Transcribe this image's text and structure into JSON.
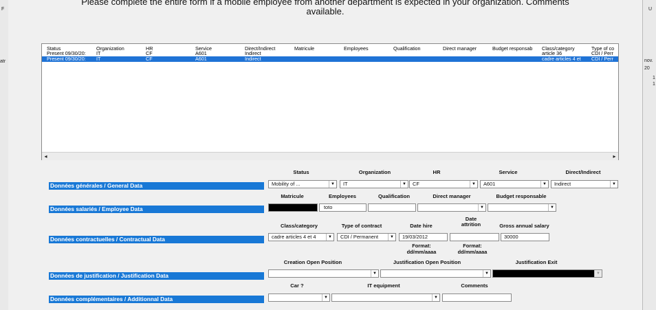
{
  "dialog": {
    "header_line1": "Please complete the entire form if a mobile employee from another department is expected in your organization. Comments",
    "header_line2": "available."
  },
  "background": {
    "left_letter": "F",
    "left_text": "atr",
    "right_letter": "U",
    "right_text1": "nov.",
    "right_text2": "20",
    "right_text3": "1",
    "right_text4": "1"
  },
  "list": {
    "columns": [
      "Status",
      "Organization",
      "HR",
      "Service",
      "Direct/Indirect",
      "Matricule",
      "Employees",
      "Qualification",
      "Direct manager",
      "Budget responsab",
      "Class/category",
      "Type of co"
    ],
    "rows": [
      {
        "cells": [
          "Present 09/30/20:",
          "IT",
          "CF",
          "A601",
          "Indirect",
          "",
          "",
          "",
          "",
          "",
          "article 36",
          "CDI / Perr"
        ],
        "selected": false
      },
      {
        "cells": [
          "Present 09/30/20:",
          "IT",
          "CF",
          "A601",
          "Indirect",
          "",
          "",
          "",
          "",
          "",
          "cadre articles 4 et",
          "CDI / Perr"
        ],
        "selected": true
      }
    ],
    "scroll_left": "◂",
    "scroll_right": "▸"
  },
  "general": {
    "label": "Données générales / General Data",
    "headers": {
      "status": "Status",
      "organization": "Organization",
      "hr": "HR",
      "service": "Service",
      "direct": "Direct/Indirect"
    },
    "values": {
      "status": "Mobility of ...",
      "organization": "IT",
      "hr": "CF",
      "service": "A601",
      "direct": "Indirect"
    }
  },
  "employee": {
    "label": "Données salariés / Employee Data",
    "headers": {
      "matricule": "Matricule",
      "employees": "Employees",
      "qualification": "Qualification",
      "manager": "Direct manager",
      "budget": "Budget responsable"
    },
    "values": {
      "matricule": "",
      "employees": "toto",
      "qualification": "",
      "manager": "",
      "budget": ""
    }
  },
  "contract": {
    "label": "Données contractuelles / Contractual Data",
    "headers": {
      "class": "Class/category",
      "type": "Type of contract",
      "hire": "Date hire",
      "attrition1": "Date",
      "attrition2": "attrition",
      "salary": "Gross annual salary"
    },
    "values": {
      "class": "cadre articles 4 et 4",
      "type": "CDI / Permanent",
      "hire": "19/03/2012",
      "attrition": "",
      "salary": "30000"
    },
    "format1a": "Format:",
    "format1b": "dd/mm/aaaa",
    "format2a": "Format:",
    "format2b": "dd/mm/aaaa"
  },
  "justification": {
    "label": "Données de justification / Justification Data",
    "headers": {
      "creation": "Creation Open Position",
      "justification": "Justification Open Position",
      "exit": "Justification Exit"
    },
    "values": {
      "creation": "",
      "justification": "",
      "exit": ""
    }
  },
  "additional": {
    "label": "Données complémentaires / Additionnal Data",
    "headers": {
      "car": "Car ?",
      "it": "IT equipment",
      "comments": "Comments"
    },
    "values": {
      "car": "",
      "it": "",
      "comments": ""
    }
  },
  "icons": {
    "dropdown": "chevron-down-icon"
  },
  "colors": {
    "accent": "#1878d6",
    "selection": "#1f73d6",
    "dialog_bg": "#f0f0f0"
  }
}
